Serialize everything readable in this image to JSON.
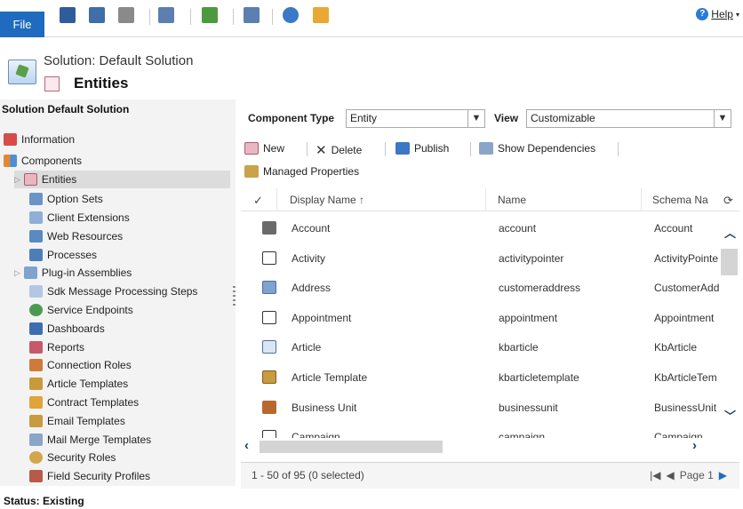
{
  "toolbar": {
    "file_label": "File",
    "help_label": "Help"
  },
  "header": {
    "solution_label": "Solution: Default Solution",
    "page_title": "Entities"
  },
  "left_panel": {
    "heading": "Solution Default Solution",
    "items": [
      {
        "label": "Information",
        "icon": "information-icon"
      },
      {
        "label": "Components",
        "icon": "components-icon"
      },
      {
        "label": "Entities",
        "icon": "entities-icon"
      },
      {
        "label": "Option Sets",
        "icon": "option-sets-icon"
      },
      {
        "label": "Client Extensions",
        "icon": "client-extensions-icon"
      },
      {
        "label": "Web Resources",
        "icon": "web-resources-icon"
      },
      {
        "label": "Processes",
        "icon": "processes-icon"
      },
      {
        "label": "Plug-in Assemblies",
        "icon": "plugin-assemblies-icon"
      },
      {
        "label": "Sdk Message Processing Steps",
        "icon": "sdk-steps-icon"
      },
      {
        "label": "Service Endpoints",
        "icon": "service-endpoints-icon"
      },
      {
        "label": "Dashboards",
        "icon": "dashboards-icon"
      },
      {
        "label": "Reports",
        "icon": "reports-icon"
      },
      {
        "label": "Connection Roles",
        "icon": "connection-roles-icon"
      },
      {
        "label": "Article Templates",
        "icon": "article-templates-icon"
      },
      {
        "label": "Contract Templates",
        "icon": "contract-templates-icon"
      },
      {
        "label": "Email Templates",
        "icon": "email-templates-icon"
      },
      {
        "label": "Mail Merge Templates",
        "icon": "mail-merge-templates-icon"
      },
      {
        "label": "Security Roles",
        "icon": "security-roles-icon"
      },
      {
        "label": "Field Security Profiles",
        "icon": "field-security-profiles-icon"
      }
    ]
  },
  "filters": {
    "component_type_label": "Component Type",
    "component_type_value": "Entity",
    "view_label": "View",
    "view_value": "Customizable"
  },
  "actions": {
    "new": "New",
    "delete": "Delete",
    "publish": "Publish",
    "show_dependencies": "Show Dependencies",
    "managed_properties": "Managed Properties"
  },
  "grid": {
    "columns": {
      "display_name": "Display Name ↑",
      "name": "Name",
      "schema_name": "Schema Na"
    },
    "rows": [
      {
        "display": "Account",
        "name": "account",
        "schema": "Account"
      },
      {
        "display": "Activity",
        "name": "activitypointer",
        "schema": "ActivityPointe"
      },
      {
        "display": "Address",
        "name": "customeraddress",
        "schema": "CustomerAdd"
      },
      {
        "display": "Appointment",
        "name": "appointment",
        "schema": "Appointment"
      },
      {
        "display": "Article",
        "name": "kbarticle",
        "schema": "KbArticle"
      },
      {
        "display": "Article Template",
        "name": "kbarticletemplate",
        "schema": "KbArticleTem"
      },
      {
        "display": "Business Unit",
        "name": "businessunit",
        "schema": "BusinessUnit"
      },
      {
        "display": "Campaign",
        "name": "campaign",
        "schema": "Campaign"
      }
    ]
  },
  "footer": {
    "count": "1 - 50 of 95 (0 selected)",
    "page": "Page 1"
  },
  "status": "Status: Existing"
}
